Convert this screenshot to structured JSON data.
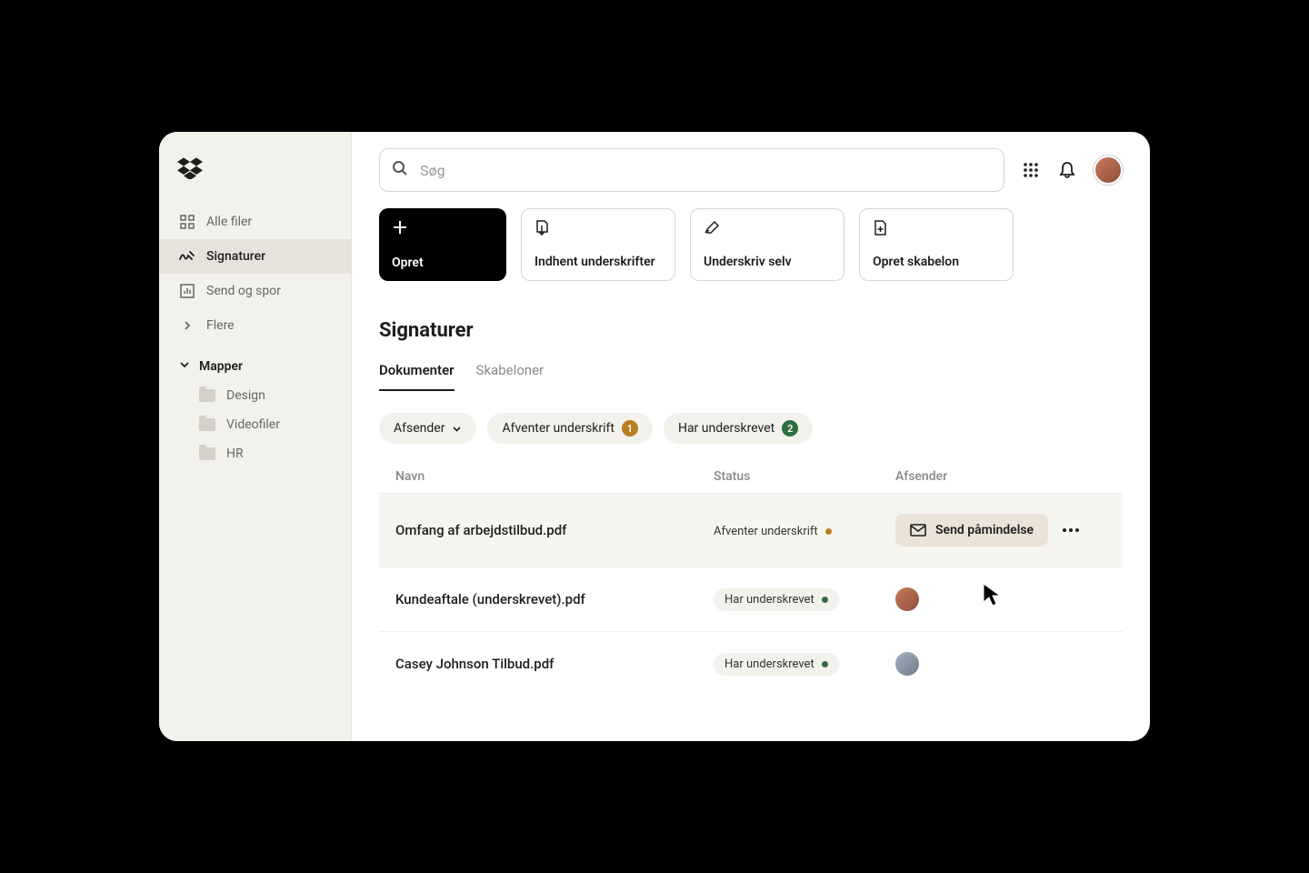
{
  "search": {
    "placeholder": "Søg"
  },
  "sidebar": {
    "items": [
      {
        "label": "Alle filer"
      },
      {
        "label": "Signaturer"
      },
      {
        "label": "Send og spor"
      },
      {
        "label": "Flere"
      }
    ],
    "folders_header": "Mapper",
    "folders": [
      {
        "label": "Design"
      },
      {
        "label": "Videofiler"
      },
      {
        "label": "HR"
      }
    ]
  },
  "action_cards": [
    {
      "label": "Opret"
    },
    {
      "label": "Indhent underskrifter"
    },
    {
      "label": "Underskriv selv"
    },
    {
      "label": "Opret skabelon"
    }
  ],
  "page_title": "Signaturer",
  "tabs": [
    {
      "label": "Dokumenter"
    },
    {
      "label": "Skabeloner"
    }
  ],
  "filters": {
    "sender_label": "Afsender",
    "awaiting_label": "Afventer underskrift",
    "awaiting_count": "1",
    "signed_label": "Har underskrevet",
    "signed_count": "2"
  },
  "table": {
    "headers": {
      "name": "Navn",
      "status": "Status",
      "sender": "Afsender"
    },
    "rows": [
      {
        "name": "Omfang af arbejdstilbud.pdf",
        "status": "Afventer underskrift",
        "status_color": "orange",
        "reminder_label": "Send påmindelse"
      },
      {
        "name": "Kundeaftale (underskrevet).pdf",
        "status": "Har underskrevet",
        "status_color": "green"
      },
      {
        "name": "Casey Johnson Tilbud.pdf",
        "status": "Har underskrevet",
        "status_color": "green"
      }
    ]
  }
}
